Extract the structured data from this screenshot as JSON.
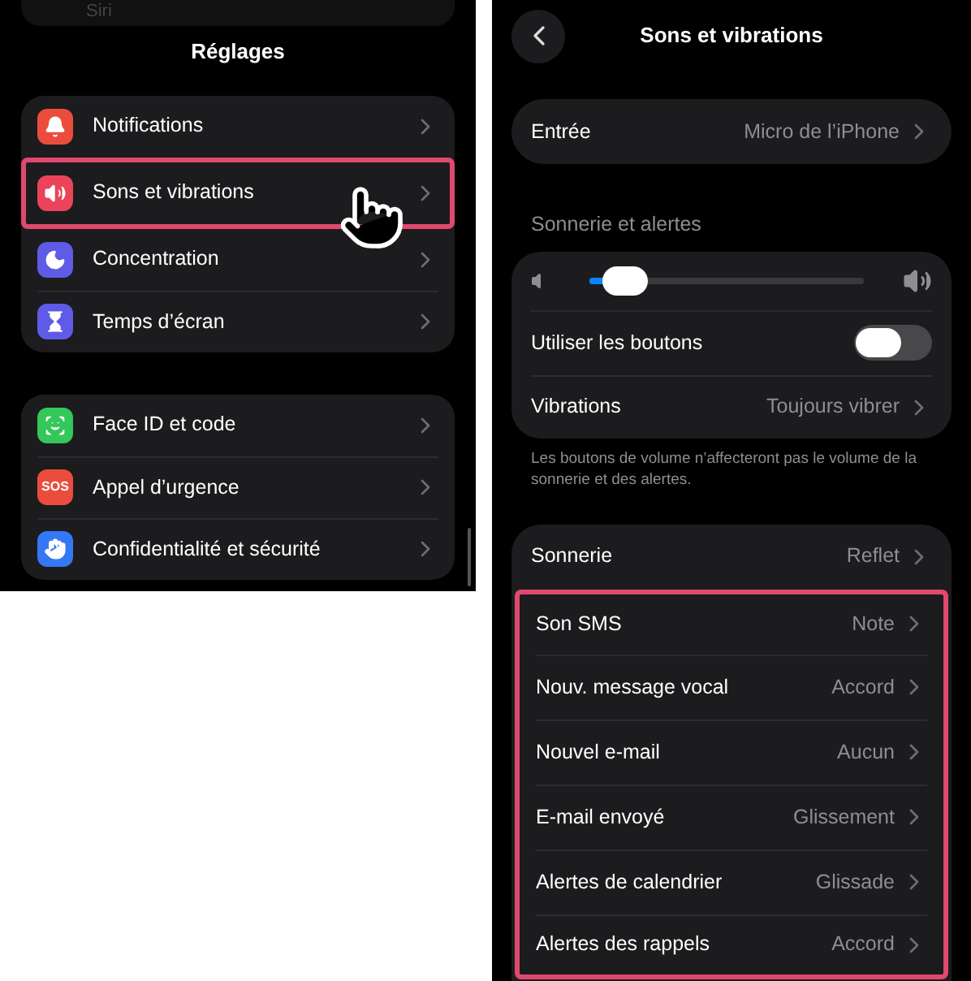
{
  "settings": {
    "faded_row": "Siri",
    "title": "Réglages",
    "groups": [
      {
        "rows": [
          {
            "label": "Notifications",
            "color": "#eb4d3d",
            "highlighted": false
          },
          {
            "label": "Sons et vibrations",
            "color": "#eb445a",
            "highlighted": true
          },
          {
            "label": "Concentration",
            "color": "#5e5ce6",
            "highlighted": false
          },
          {
            "label": "Temps d’écran",
            "color": "#5e5ce6",
            "highlighted": false
          }
        ]
      },
      {
        "rows": [
          {
            "label": "Face ID et code",
            "color": "#34c759",
            "highlighted": false
          },
          {
            "label": "Appel d’urgence",
            "color": "#eb4d3d",
            "icon_text": "SOS",
            "highlighted": false
          },
          {
            "label": "Confidentialité et sécurité",
            "color": "#3478f6",
            "highlighted": false
          }
        ]
      }
    ]
  },
  "sounds": {
    "title": "Sons et vibrations",
    "input": {
      "label": "Entrée",
      "value": "Micro de l’iPhone"
    },
    "section_header": "Sonnerie et alertes",
    "volume": {
      "level": 0.13
    },
    "use_buttons": {
      "label": "Utiliser les boutons",
      "on": false
    },
    "vibrations": {
      "label": "Vibrations",
      "value": "Toujours vibrer"
    },
    "footer": "Les boutons de volume n’affecteront pas le volume de la sonnerie et des alertes.",
    "tones": [
      {
        "label": "Sonnerie",
        "value": "Reflet",
        "highlighted": false
      },
      {
        "label": "Son SMS",
        "value": "Note",
        "highlighted": true
      },
      {
        "label": "Nouv. message vocal",
        "value": "Accord",
        "highlighted": true
      },
      {
        "label": "Nouvel e-mail",
        "value": "Aucun",
        "highlighted": true
      },
      {
        "label": "E-mail envoyé",
        "value": "Glissement",
        "highlighted": true
      },
      {
        "label": "Alertes de calendrier",
        "value": "Glissade",
        "highlighted": true
      },
      {
        "label": "Alertes des rappels",
        "value": "Accord",
        "highlighted": true
      }
    ]
  }
}
